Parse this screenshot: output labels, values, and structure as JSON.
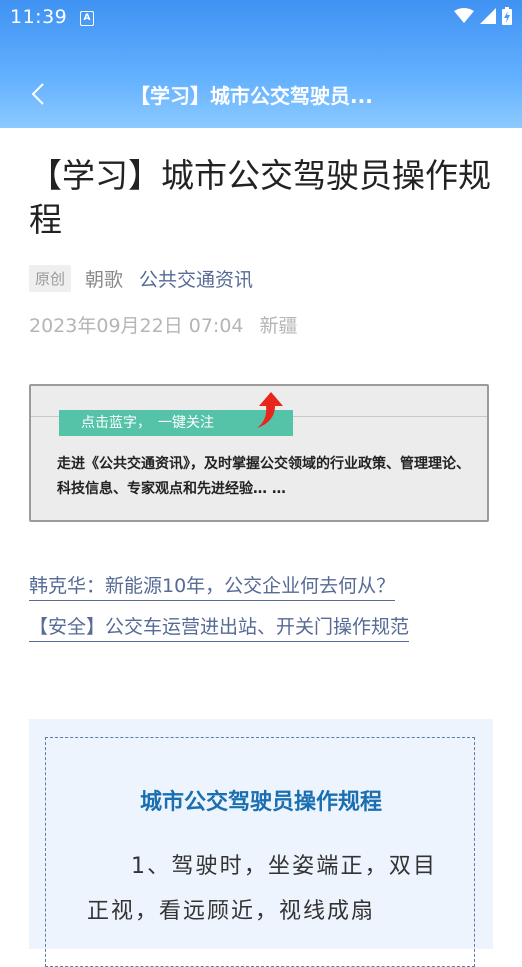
{
  "status_bar": {
    "time": "11:39",
    "a_icon": "A"
  },
  "nav": {
    "back_icon": "chevron-left-icon",
    "title": "【学习】城市公交驾驶员..."
  },
  "article": {
    "title": "【学习】城市公交驾驶员操作规程",
    "tag": "原创",
    "author": "朝歌",
    "account": "公共交通资讯",
    "date": "2023年09月22日 07:04",
    "location": "新疆"
  },
  "banner": {
    "strip_label": "点击蓝字，　一键关注",
    "text": "走进《公共交通资讯》，及时掌握公交领域的行业政策、管理理论、科技信息、专家观点和先进经验… …"
  },
  "related_links": [
    "韩克华：新能源10年，公交企业何去何从？",
    "【安全】公交车运营进出站、开关门操作规范"
  ],
  "content": {
    "section_title": "城市公交驾驶员操作规程",
    "paragraph": "1、驾驶时，坐姿端正，双目正视，看远顾近，视线成扇"
  },
  "colors": {
    "header": "#4a9bf5",
    "link": "#576b95",
    "section_title": "#1a6fb0",
    "banner_strip": "#55c3a8"
  }
}
